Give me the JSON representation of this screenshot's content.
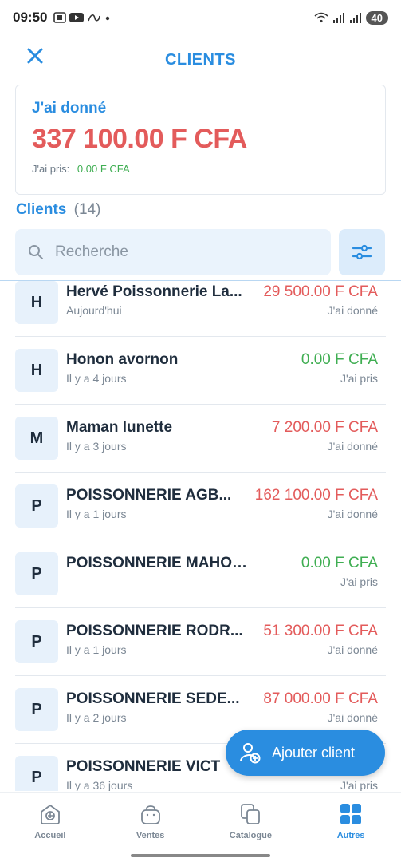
{
  "status_bar": {
    "time": "09:50",
    "battery": "40"
  },
  "header": {
    "title": "CLIENTS"
  },
  "summary": {
    "label": "J'ai donné",
    "amount": "337 100.00 F CFA",
    "sub_label": "J'ai pris:",
    "sub_value": "0.00 F CFA"
  },
  "clients_heading": {
    "label": "Clients",
    "count": "(14)"
  },
  "search": {
    "placeholder": "Recherche"
  },
  "clients": [
    {
      "initial": "H",
      "name": "Hervé Poissonnerie La...",
      "date": "Aujourd'hui",
      "amount": "29 500.00 F CFA",
      "type": "J'ai donné",
      "color": "#e35b5b"
    },
    {
      "initial": "H",
      "name": "Honon avornon",
      "date": "Il y a 4 jours",
      "amount": "0.00 F CFA",
      "type": "J'ai pris",
      "color": "#3fae52"
    },
    {
      "initial": "M",
      "name": "Maman lunette",
      "date": "Il y a 3 jours",
      "amount": "7 200.00 F CFA",
      "type": "J'ai donné",
      "color": "#e35b5b"
    },
    {
      "initial": "P",
      "name": "POISSONNERIE AGB...",
      "date": "Il y a 1 jours",
      "amount": "162 100.00 F CFA",
      "type": "J'ai donné",
      "color": "#e35b5b"
    },
    {
      "initial": "P",
      "name": "POISSONNERIE MAHOUGN...",
      "date": "",
      "amount": "0.00 F CFA",
      "type": "J'ai pris",
      "color": "#3fae52"
    },
    {
      "initial": "P",
      "name": "POISSONNERIE RODR...",
      "date": "Il y a 1 jours",
      "amount": "51 300.00 F CFA",
      "type": "J'ai donné",
      "color": "#e35b5b"
    },
    {
      "initial": "P",
      "name": "POISSONNERIE SEDE...",
      "date": "Il y a 2 jours",
      "amount": "87 000.00 F CFA",
      "type": "J'ai donné",
      "color": "#e35b5b"
    },
    {
      "initial": "P",
      "name": "POISSONNERIE VICT",
      "date": "Il y a 36 jours",
      "amount": "",
      "type": "J'ai pris",
      "color": "#3fae52"
    }
  ],
  "fab": {
    "label": "Ajouter client",
    "icon": "add-user-icon"
  },
  "nav": [
    {
      "label": "Accueil",
      "icon": "home-icon"
    },
    {
      "label": "Ventes",
      "icon": "bag-icon"
    },
    {
      "label": "Catalogue",
      "icon": "catalog-icon"
    },
    {
      "label": "Autres",
      "icon": "grid-icon"
    }
  ],
  "colors": {
    "accent": "#2a8de0",
    "debt": "#e35b5b",
    "credit": "#3fae52"
  }
}
